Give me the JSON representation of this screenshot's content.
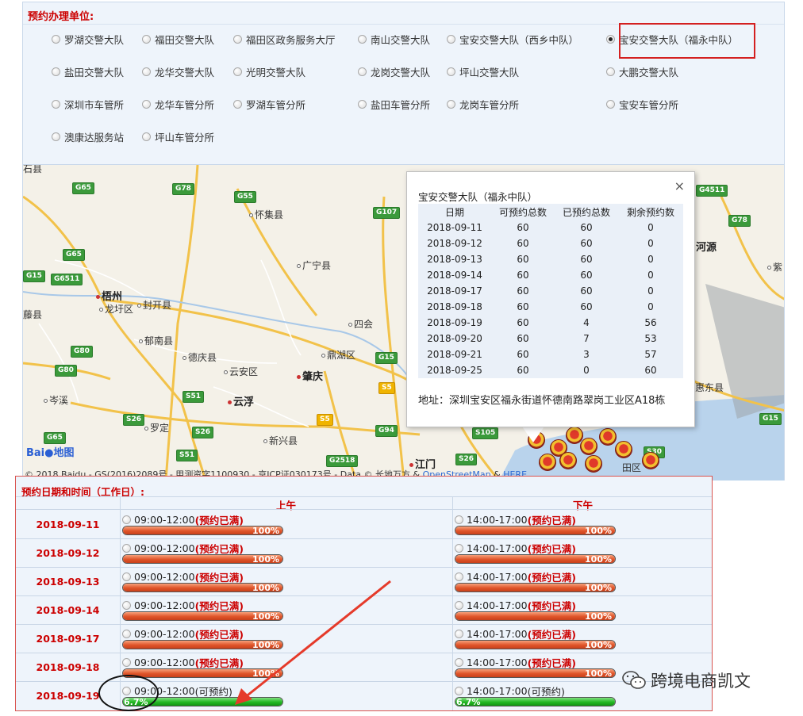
{
  "unit_panel": {
    "title": "预约办理单位:",
    "options": [
      {
        "label": "罗湖交警大队",
        "checked": false
      },
      {
        "label": "福田交警大队",
        "checked": false
      },
      {
        "label": "福田区政务服务大厅",
        "checked": false
      },
      {
        "label": "南山交警大队",
        "checked": false
      },
      {
        "label": "宝安交警大队（西乡中队）",
        "checked": false
      },
      {
        "label": "宝安交警大队（福永中队）",
        "checked": true
      },
      {
        "label": "盐田交警大队",
        "checked": false
      },
      {
        "label": "龙华交警大队",
        "checked": false
      },
      {
        "label": "光明交警大队",
        "checked": false
      },
      {
        "label": "龙岗交警大队",
        "checked": false
      },
      {
        "label": "坪山交警大队",
        "checked": false
      },
      {
        "label": "大鹏交警大队",
        "checked": false
      },
      {
        "label": "深圳市车管所",
        "checked": false
      },
      {
        "label": "龙华车管分所",
        "checked": false
      },
      {
        "label": "罗湖车管分所",
        "checked": false
      },
      {
        "label": "盐田车管分所",
        "checked": false
      },
      {
        "label": "龙岗车管分所",
        "checked": false
      },
      {
        "label": "宝安车管分所",
        "checked": false
      },
      {
        "label": "澳康达服务站",
        "checked": false
      },
      {
        "label": "坪山车管分所",
        "checked": false
      }
    ]
  },
  "map": {
    "cities": [
      "怀集县",
      "广宁县",
      "梧州",
      "龙圩区",
      "封开县",
      "藤县",
      "郁南县",
      "德庆县",
      "云安区",
      "肇庆",
      "鼎湖区",
      "四会",
      "岑溪",
      "云浮",
      "罗定",
      "新兴县",
      "江门",
      "河源",
      "惠东县",
      "田区",
      "紫",
      "石县"
    ],
    "highways": [
      "G65",
      "G78",
      "G55",
      "G107",
      "G4511",
      "G78",
      "G65",
      "G6511",
      "G80",
      "G80",
      "G15",
      "S5",
      "S51",
      "S26",
      "S26",
      "S5",
      "G94",
      "S105",
      "G2518",
      "S26",
      "S30",
      "G15",
      "S51",
      "G65",
      "G15"
    ],
    "logo_a": "Bai",
    "logo_b": "地图",
    "copyright_text": "© 2018 Baidu - GS(2016)2089号 - 甲测资字1100930 - 京ICP证030173号 - Data © 长地万方 &",
    "osm_link": "OpenStreetMap",
    "amp": "&",
    "here_link": "HERE"
  },
  "popup": {
    "title": "宝安交警大队（福永中队）",
    "close": "×",
    "headers": [
      "日期",
      "可预约总数",
      "已预约总数",
      "剩余预约数"
    ],
    "rows": [
      [
        "2018-09-11",
        "60",
        "60",
        "0"
      ],
      [
        "2018-09-12",
        "60",
        "60",
        "0"
      ],
      [
        "2018-09-13",
        "60",
        "60",
        "0"
      ],
      [
        "2018-09-14",
        "60",
        "60",
        "0"
      ],
      [
        "2018-09-17",
        "60",
        "60",
        "0"
      ],
      [
        "2018-09-18",
        "60",
        "60",
        "0"
      ],
      [
        "2018-09-19",
        "60",
        "4",
        "56"
      ],
      [
        "2018-09-20",
        "60",
        "7",
        "53"
      ],
      [
        "2018-09-21",
        "60",
        "3",
        "57"
      ],
      [
        "2018-09-25",
        "60",
        "0",
        "60"
      ]
    ],
    "address": "地址：深圳宝安区福永街道怀德南路翠岗工业区A18栋"
  },
  "booking": {
    "title": "预约日期和时间（工作日）:",
    "am_header": "上午",
    "pm_header": "下午",
    "rows": [
      {
        "date": "2018-09-11",
        "am": {
          "time": "09:00-12:00",
          "status": "(预约已满)",
          "full": true,
          "percent_label": "100%",
          "fill": 1.0
        },
        "pm": {
          "time": "14:00-17:00",
          "status": "(预约已满)",
          "full": true,
          "percent_label": "100%",
          "fill": 1.0
        }
      },
      {
        "date": "2018-09-12",
        "am": {
          "time": "09:00-12:00",
          "status": "(预约已满)",
          "full": true,
          "percent_label": "100%",
          "fill": 1.0
        },
        "pm": {
          "time": "14:00-17:00",
          "status": "(预约已满)",
          "full": true,
          "percent_label": "100%",
          "fill": 1.0
        }
      },
      {
        "date": "2018-09-13",
        "am": {
          "time": "09:00-12:00",
          "status": "(预约已满)",
          "full": true,
          "percent_label": "100%",
          "fill": 1.0
        },
        "pm": {
          "time": "14:00-17:00",
          "status": "(预约已满)",
          "full": true,
          "percent_label": "100%",
          "fill": 1.0
        }
      },
      {
        "date": "2018-09-14",
        "am": {
          "time": "09:00-12:00",
          "status": "(预约已满)",
          "full": true,
          "percent_label": "100%",
          "fill": 1.0
        },
        "pm": {
          "time": "14:00-17:00",
          "status": "(预约已满)",
          "full": true,
          "percent_label": "100%",
          "fill": 1.0
        }
      },
      {
        "date": "2018-09-17",
        "am": {
          "time": "09:00-12:00",
          "status": "(预约已满)",
          "full": true,
          "percent_label": "100%",
          "fill": 1.0
        },
        "pm": {
          "time": "14:00-17:00",
          "status": "(预约已满)",
          "full": true,
          "percent_label": "100%",
          "fill": 1.0
        }
      },
      {
        "date": "2018-09-18",
        "am": {
          "time": "09:00-12:00",
          "status": "(预约已满)",
          "full": true,
          "percent_label": "100%",
          "fill": 1.0
        },
        "pm": {
          "time": "14:00-17:00",
          "status": "(预约已满)",
          "full": true,
          "percent_label": "100%",
          "fill": 1.0
        }
      },
      {
        "date": "2018-09-19",
        "am": {
          "time": "09:00-12:00",
          "status": "(可预约)",
          "full": false,
          "percent_label": "6.7%",
          "fill": 1.0
        },
        "pm": {
          "time": "14:00-17:00",
          "status": "(可预约)",
          "full": false,
          "percent_label": "6.7%",
          "fill": 1.0
        }
      }
    ]
  },
  "watermark": {
    "text": "跨境电商凯文",
    "icon": "wechat-icon"
  },
  "colors": {
    "accent_red": "#cc0000",
    "full_bar": "#e0552a",
    "open_bar": "#22b822",
    "panel_bg": "#eef4fb"
  }
}
